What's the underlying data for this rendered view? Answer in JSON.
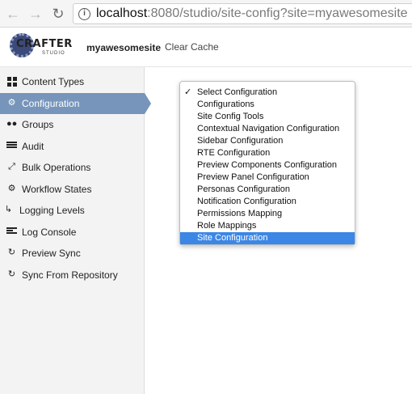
{
  "browser": {
    "url_host": "localhost",
    "url_rest": ":8080/studio/site-config?site=myawesomesite"
  },
  "header": {
    "logo_text": "CRAFTER",
    "logo_sub": "STUDIO",
    "site_name": "myawesomesite",
    "clear_cache": "Clear Cache"
  },
  "sidebar": {
    "items": [
      {
        "label": "Content Types",
        "icon": "grid-icon"
      },
      {
        "label": "Configuration",
        "icon": "gear-icon",
        "active": true
      },
      {
        "label": "Groups",
        "icon": "users-icon"
      },
      {
        "label": "Audit",
        "icon": "list-icon"
      },
      {
        "label": "Bulk Operations",
        "icon": "expand-icon"
      },
      {
        "label": "Workflow States",
        "icon": "cog-icon"
      },
      {
        "label": "Logging Levels",
        "icon": "level-down-icon"
      },
      {
        "label": "Log Console",
        "icon": "align-left-icon"
      },
      {
        "label": "Preview Sync",
        "icon": "refresh-icon"
      },
      {
        "label": "Sync From Repository",
        "icon": "refresh-icon"
      }
    ]
  },
  "dropdown": {
    "options": [
      "Select Configuration",
      "Configurations",
      "Site Config Tools",
      "Contextual Navigation Configuration",
      "Sidebar Configuration",
      "RTE Configuration",
      "Preview Components Configuration",
      "Preview Panel Configuration",
      "Personas Configuration",
      "Notification Configuration",
      "Permissions Mapping",
      "Role Mappings",
      "Site Configuration"
    ],
    "checked_index": 0,
    "highlighted_index": 12,
    "highlight_color": "#3c87e6"
  },
  "colors": {
    "active_sidebar": "#7795bb"
  }
}
